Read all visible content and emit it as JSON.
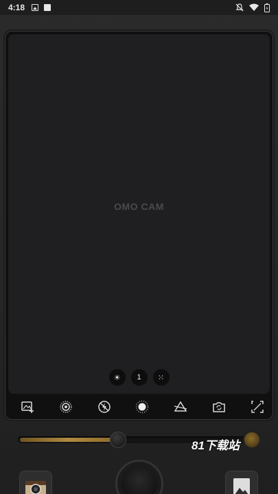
{
  "status_bar": {
    "time": "4:18",
    "icons": [
      "image-notification-icon",
      "a-notification-icon",
      "mute-icon",
      "wifi-icon",
      "battery-icon"
    ]
  },
  "viewfinder": {
    "logo": "OMO CAM",
    "controls": {
      "brightness": "☀",
      "count": "1",
      "grid": "⁙"
    }
  },
  "toolbar": {
    "tools": [
      "add-image-icon",
      "lens-filter-icon",
      "flash-off-icon",
      "exposure-icon",
      "prism-icon",
      "switch-camera-icon",
      "crop-expand-icon"
    ]
  },
  "slider": {
    "value_fraction": 0.42
  },
  "watermark": "81下载站",
  "colors": {
    "accent": "#b08a3e",
    "background": "#262626",
    "viewfinder": "#1f1e20"
  }
}
